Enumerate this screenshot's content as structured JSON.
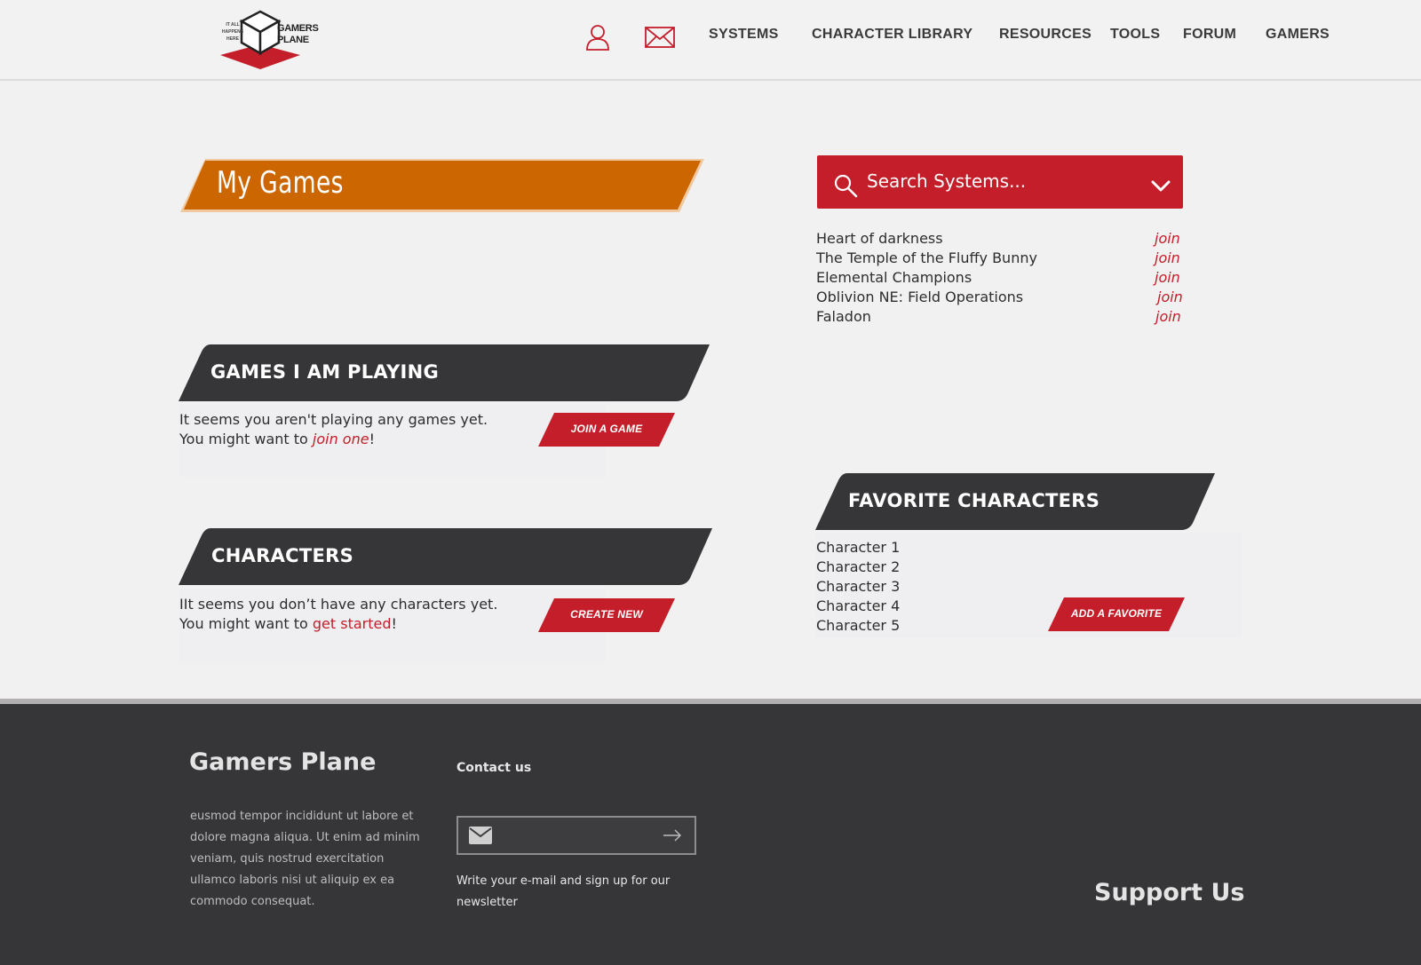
{
  "header": {
    "logo": {
      "tagline": "IT ALL HAPPENS HERE",
      "name_line1": "GAMERS",
      "name_line2": "PLANE"
    },
    "icons": [
      "user-icon",
      "mail-icon"
    ],
    "nav": {
      "systems": "SYSTEMS",
      "character_library": "CHARACTER LIBRARY",
      "resources": "RESOURCES",
      "tools": "TOOLS",
      "forum": "FORUM",
      "gamers": "GAMERS"
    }
  },
  "my_games": {
    "title": "My Games"
  },
  "games_playing": {
    "title": "GAMES I AM PLAYING",
    "line1": "It seems you aren't playing any games yet.",
    "line2_prefix": "You might want to ",
    "line2_link": "join one",
    "line2_suffix": "!",
    "button": "JOIN A GAME"
  },
  "characters": {
    "title": "CHARACTERS",
    "line1": "IIt seems you don’t have any characters yet.",
    "line2_prefix": "You might want to ",
    "line2_link": "get started",
    "line2_suffix": "!",
    "button": "CREATE NEW"
  },
  "search": {
    "placeholder": "Search Systems...",
    "icon": "search-icon",
    "dropdown_icon": "chevron-down-icon"
  },
  "systems_list": [
    {
      "name": "Heart of darkness",
      "action": "join"
    },
    {
      "name": "The Temple of the Fluffy Bunny",
      "action": "join"
    },
    {
      "name": "Elemental Champions",
      "action": "join"
    },
    {
      "name": "Oblivion NE: Field Operations",
      "action": "join"
    },
    {
      "name": "Faladon",
      "action": "join"
    }
  ],
  "favorite_characters": {
    "title": "FAVORITE CHARACTERS",
    "items": [
      "Character 1",
      "Character 2",
      "Character 3",
      "Character 4",
      "Character 5"
    ],
    "button": "ADD A FAVORITE"
  },
  "footer": {
    "brand": "Gamers Plane",
    "body": "eusmod tempor incididunt ut labore et dolore magna aliqua. Ut enim ad minim veniam, quis nostrud exercitation ullamco laboris nisi ut aliquip ex ea commodo consequat.",
    "contact": "Contact us",
    "email_value": "",
    "newsletter_note": "Write your e-mail and sign up for our newsletter",
    "support": "Support Us"
  },
  "colors": {
    "brand_red": "#c41e2a",
    "orange": "#cc6600",
    "dark": "#363638",
    "background": "#f1f1f1"
  }
}
